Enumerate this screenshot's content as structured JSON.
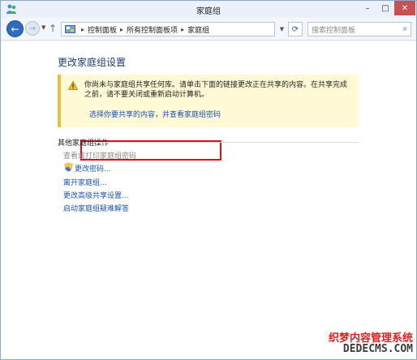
{
  "window": {
    "title": "家庭组"
  },
  "title_buttons": {
    "minimize": "–",
    "maximize": "□",
    "close": "✕"
  },
  "address_bar": {
    "breadcrumbs": [
      "控制面板",
      "所有控制面板项",
      "家庭组"
    ],
    "separator": "▸"
  },
  "search": {
    "placeholder": "搜索控制面板"
  },
  "main": {
    "heading": "更改家庭组设置",
    "notice": {
      "text": "你尚未与家庭组共享任何库。请单击下面的链接更改正在共享的内容。在共享完成之前，请不要关闭或重新启动计算机。",
      "link": "选择你要共享的内容，并查看家庭组密码"
    },
    "other_actions": {
      "title": "其他家庭组操作",
      "items": [
        {
          "label": "查看或打印家庭组密码",
          "enabled": false
        },
        {
          "label": "更改密码...",
          "enabled": true,
          "icon": "shield-icon"
        },
        {
          "label": "离开家庭组...",
          "enabled": true
        },
        {
          "label": "更改高级共享设置...",
          "enabled": true
        },
        {
          "label": "启动家庭组疑难解答",
          "enabled": true
        }
      ]
    }
  },
  "watermark": {
    "line1": "织梦内容管理系统",
    "line2": "DEDECMS.COM"
  },
  "colors": {
    "link": "#1a53b5",
    "heading": "#1e3f78",
    "highlight": "#e0101a",
    "notice_bg": "#fff9d6"
  }
}
